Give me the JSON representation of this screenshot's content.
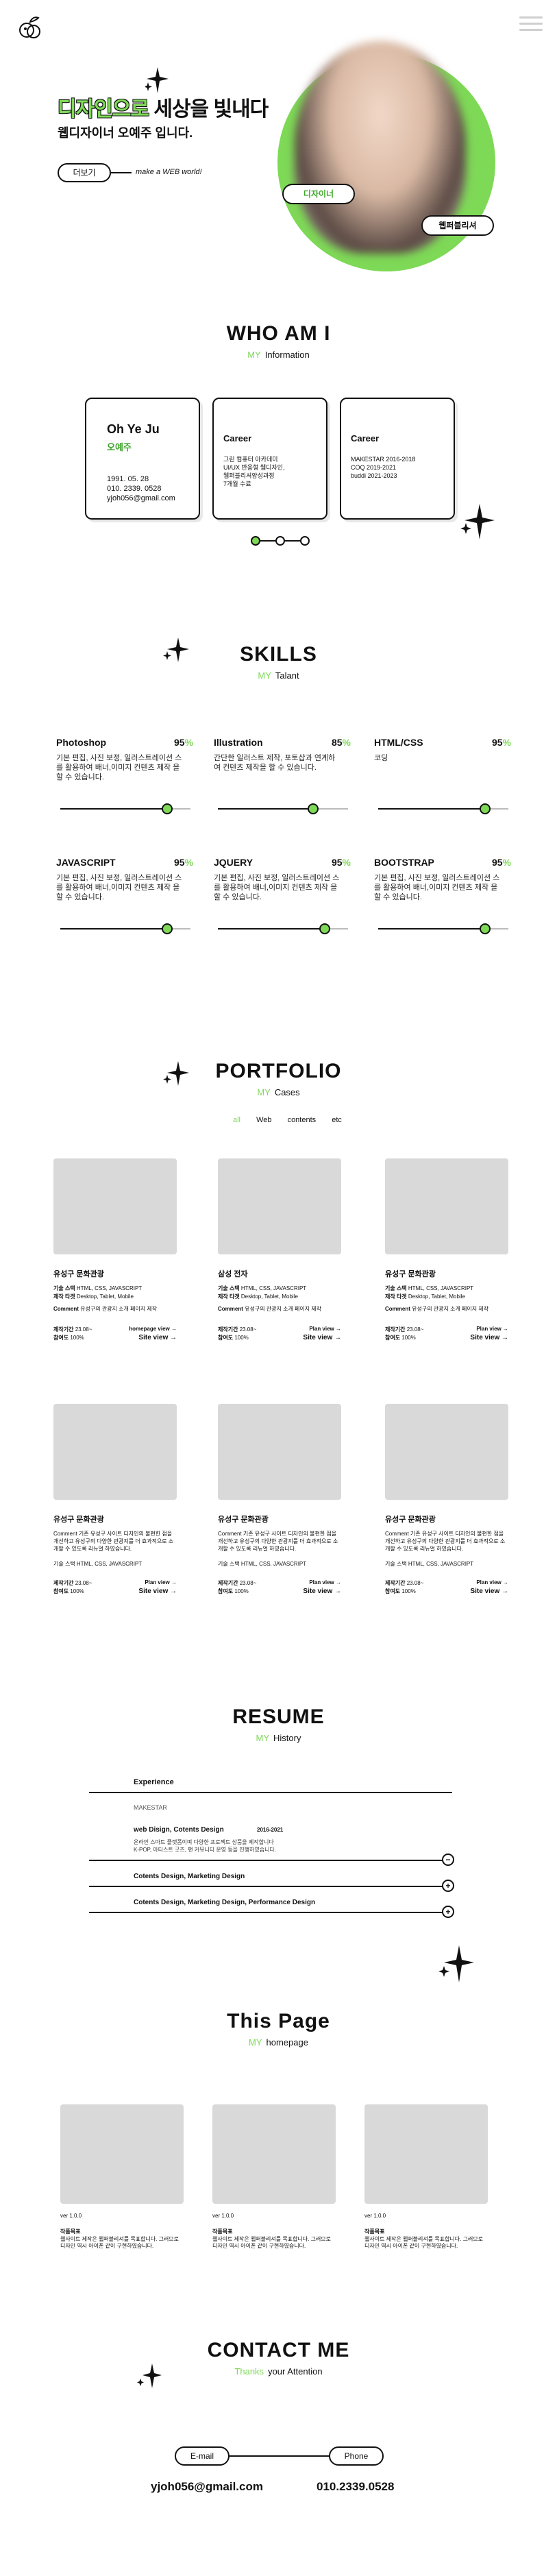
{
  "header": {
    "logo": "peach-logo-icon",
    "menu": "hamburger-menu-icon"
  },
  "hero": {
    "title_highlight": "디자인으로",
    "title_rest": "세상을 빛내다",
    "subtitle": "웹디자이너 오예주 입니다.",
    "button": "더보기",
    "caption": "make a WEB world!",
    "tag1": "디자이너",
    "tag2": "웹퍼블리셔"
  },
  "about": {
    "title": "WHO AM I",
    "sub_accent": "MY",
    "sub": "Information",
    "card1": {
      "name": "Oh Ye Ju",
      "kname": "오예주",
      "birth": "1991. 05. 28",
      "phone": "010. 2339. 0528",
      "email": "yjoh056@gmail.com"
    },
    "card2": {
      "title": "Career",
      "l1": "그린 컴퓨터 아카데미",
      "l2": "UI/UX 반응형 웹디자인,",
      "l3": "웹퍼블리셔양성과정",
      "l4": "7개월 수료"
    },
    "card3": {
      "title": "Career",
      "l1": "MAKESTAR 2016-2018",
      "l2": "COQ 2019-2021",
      "l3": "buddi 2021-2023"
    }
  },
  "skills": {
    "title": "SKILLS",
    "sub_accent": "MY",
    "sub": "Talant",
    "items": [
      {
        "name": "Photoshop",
        "num": "95",
        "desc": "기본 편집, 사진 보정, 일러스트레이션 스를 활용하여 배너,이미지 컨텐츠 제작 을 할 수 있습니다.",
        "level": 0.95
      },
      {
        "name": "Illustration",
        "num": "85",
        "desc": "간단한 일러스트 제작, 포토샵과 연계하 여 컨텐츠 제작을 할 수 있습니다.",
        "level": 0.85
      },
      {
        "name": "HTML/CSS",
        "num": "95",
        "desc": "코딩",
        "level": 0.95
      },
      {
        "name": "JAVASCRIPT",
        "num": "95",
        "desc": "기본 편집, 사진 보정, 일러스트레이션 스를 활용하여 배너,이미지 컨텐츠 제작 을 할 수 있습니다.",
        "level": 0.95
      },
      {
        "name": "JQUERY",
        "num": "95",
        "desc": "기본 편집, 사진 보정, 일러스트레이션 스를 활용하여 배너,이미지 컨텐츠 제작 을 할 수 있습니다.",
        "level": 0.95
      },
      {
        "name": "BOOTSTRAP",
        "num": "95",
        "desc": "기본 편집, 사진 보정, 일러스트레이션 스를 활용하여 배너,이미지 컨텐츠 제작 을 할 수 있습니다.",
        "level": 0.95
      }
    ],
    "pct": "%"
  },
  "portfolio": {
    "title": "PORTFOLIO",
    "sub_accent": "MY",
    "sub": "Cases",
    "tabs": [
      "all",
      "Web",
      "contents",
      "etc"
    ],
    "row1": [
      {
        "title": "유성구 문화관광",
        "l1k": "기술 스택",
        "l1": "HTML, CSS, JAVASCRIPT",
        "l2k": "제작 타겟",
        "l2": "Desktop, Tablet, Mobile",
        "l3k": "Comment",
        "l3": "유성구의 관광지 소개 페이지 제작",
        "f1k": "제작기간",
        "f1": "23.08~",
        "f2k": "참여도",
        "f2": "100%",
        "link1": "homepage view →",
        "link2": "Site view →"
      },
      {
        "title": "삼성 전자",
        "l1k": "기술 스택",
        "l1": "HTML, CSS, JAVASCRIPT",
        "l2k": "제작 타겟",
        "l2": "Desktop, Tablet, Mobile",
        "l3k": "Comment",
        "l3": "유성구의 관광지 소개 페이지 제작",
        "f1k": "제작기간",
        "f1": "23.08~",
        "f2k": "참여도",
        "f2": "100%",
        "link1": "Plan view →",
        "link2": "Site view →"
      },
      {
        "title": "유성구 문화관광",
        "l1k": "기술 스택",
        "l1": "HTML, CSS, JAVASCRIPT",
        "l2k": "제작 타겟",
        "l2": "Desktop, Tablet, Mobile",
        "l3k": "Comment",
        "l3": "유성구의 관광지 소개 페이지 제작",
        "f1k": "제작기간",
        "f1": "23.08~",
        "f2k": "참여도",
        "f2": "100%",
        "link1": "Plan view →",
        "link2": "Site view →"
      }
    ],
    "row2": [
      {
        "title": "유성구 문화관광",
        "comment": "Comment 기존 유성구 사이트 디자인의 불편한 점을 개선하고 유성구의 다양한 관광지를 더 효과적으로 소개할 수 있도록 리뉴얼 하였습니다.",
        "stack": "기술 스택 HTML, CSS, JAVASCRIPT",
        "f1k": "제작기간",
        "f1": "23.08~",
        "f2k": "참여도",
        "f2": "100%",
        "link1": "Plan view →",
        "link2": "Site view →"
      },
      {
        "title": "유성구 문화관광",
        "comment": "Comment 기존 유성구 사이트 디자인의 불편한 점을 개선하고 유성구의 다양한 관광지를 더 효과적으로 소개할 수 있도록 리뉴얼 하였습니다.",
        "stack": "기술 스택 HTML, CSS, JAVASCRIPT",
        "f1k": "제작기간",
        "f1": "23.08~",
        "f2k": "참여도",
        "f2": "100%",
        "link1": "Plan view →",
        "link2": "Site view →"
      },
      {
        "title": "유성구 문화관광",
        "comment": "Comment 기존 유성구 사이트 디자인의 불편한 점을 개선하고 유성구의 다양한 관광지를 더 효과적으로 소개할 수 있도록 리뉴얼 하였습니다.",
        "stack": "기술 스택 HTML, CSS, JAVASCRIPT",
        "f1k": "제작기간",
        "f1": "23.08~",
        "f2k": "참여도",
        "f2": "100%",
        "link1": "Plan view →",
        "link2": "Site view →"
      }
    ]
  },
  "resume": {
    "title": "RESUME",
    "sub_accent": "MY",
    "sub": "History",
    "head": "Experience",
    "company": "MAKESTAR",
    "role": "web Disign, Cotents Design",
    "period": "2016-2021",
    "desc1": "온라인 스마트 플랫폼이며 다양한 프로젝트 상품을 제작합니다",
    "desc2": "K-POP, 아티스트 굿즈, 팬 커뮤니티 운영 등을 진행하였습니다.",
    "rows": [
      "Cotents Design, Marketing Design",
      "Cotents Design, Marketing Design, Performance Design"
    ],
    "minus": "−",
    "plus": "+"
  },
  "this_page": {
    "title": "This Page",
    "sub_accent": "MY",
    "sub": "homepage",
    "cards": [
      {
        "t1": "ver 1.0.0",
        "t2": "작품목표",
        "t3": "웹사이트 제작은 웹퍼블리셔를 목표합니다. 그러므로 디자인 역시 아이폰 같이 구현하였습니다."
      },
      {
        "t1": "ver 1.0.0",
        "t2": "작품목표",
        "t3": "웹사이트 제작은 웹퍼블리셔를 목표합니다. 그러므로 디자인 역시 아이폰 같이 구현하였습니다."
      },
      {
        "t1": "ver 1.0.0",
        "t2": "작품목표",
        "t3": "웹사이트 제작은 웹퍼블리셔를 목표합니다. 그러므로 디자인 역시 아이폰 같이 구현하였습니다."
      }
    ]
  },
  "contact": {
    "title": "CONTACT ME",
    "sub_accent": "Thanks",
    "sub": "your Attention",
    "email_btn": "E-mail",
    "phone_btn": "Phone",
    "email": "yjoh056@gmail.com",
    "phone": "010.2339.0528"
  },
  "colors": {
    "accent": "#7ed957",
    "dark": "#111111",
    "thumb": "#d9d9d9"
  }
}
